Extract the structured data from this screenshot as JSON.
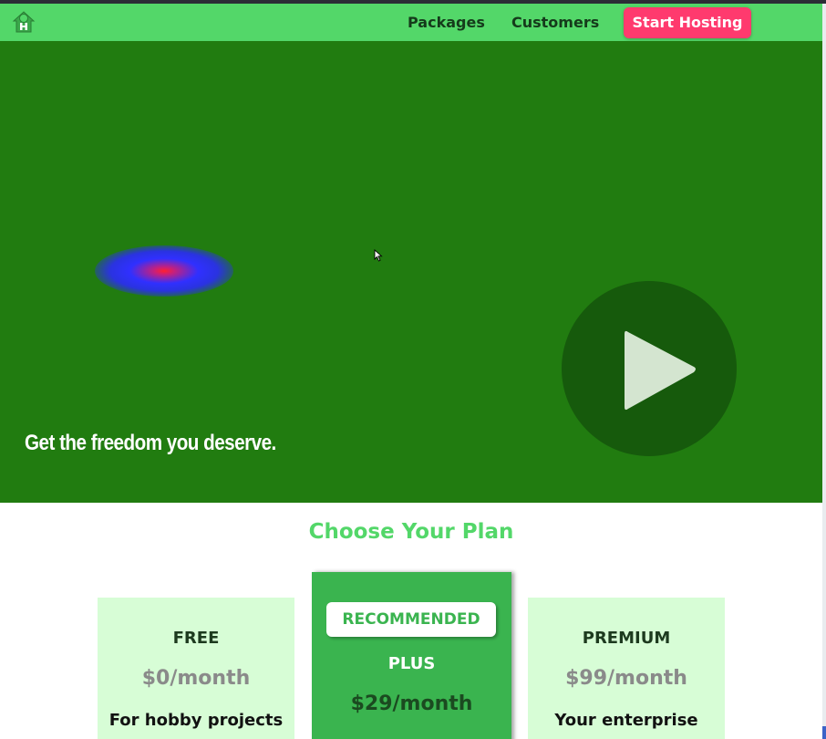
{
  "nav": {
    "logo_icon": "house-logo-icon",
    "links": [
      "Packages",
      "Customers"
    ],
    "cta_label": "Start Hosting"
  },
  "hero": {
    "tagline": "Get the freedom you deserve.",
    "play_icon": "play-icon",
    "background_color": "#217c10"
  },
  "plans": {
    "title": "Choose Your Plan",
    "items": [
      {
        "name": "FREE",
        "price": "$0/month",
        "desc": "For hobby projects"
      },
      {
        "badge": "RECOMMENDED",
        "name": "PLUS",
        "price": "$29/month"
      },
      {
        "name": "PREMIUM",
        "price": "$99/month",
        "desc": "Your enterprise"
      }
    ]
  },
  "colors": {
    "accent_green": "#53d769",
    "cta_pink": "#ff3a6e",
    "hero_green": "#217c10",
    "plus_green": "#3ab44f",
    "card_mint": "#d7fdd6"
  }
}
